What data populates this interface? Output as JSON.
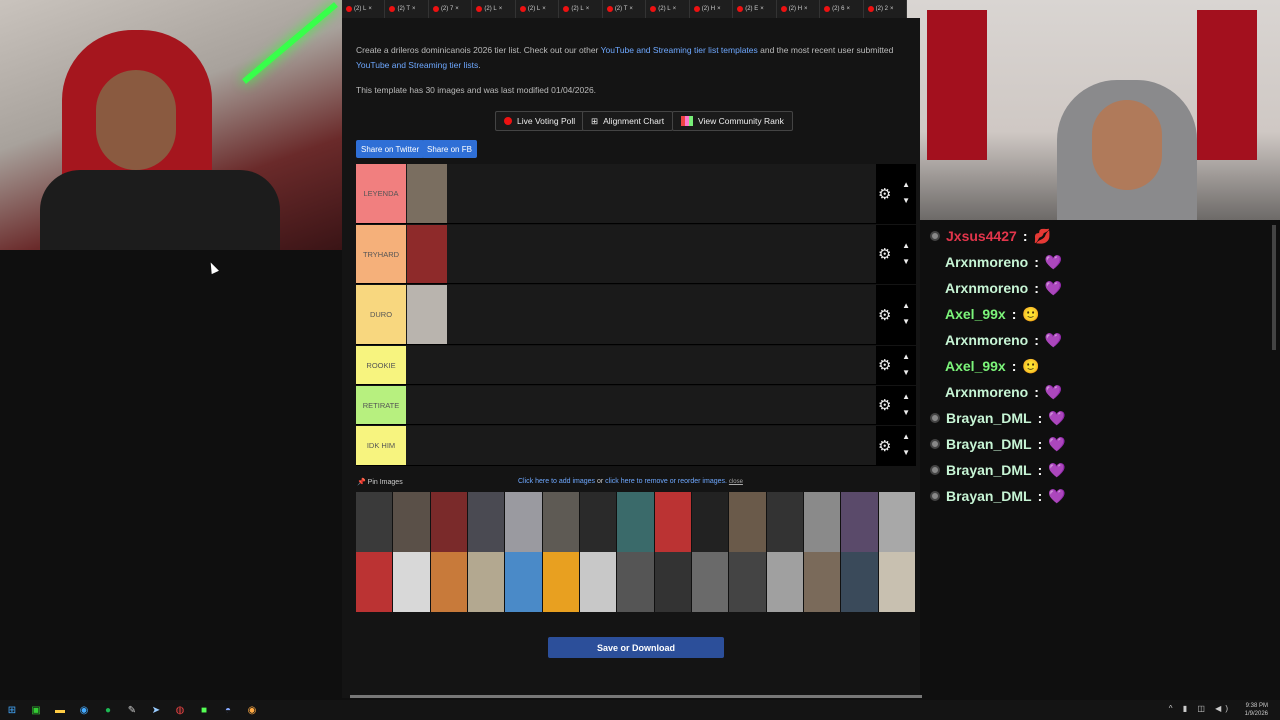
{
  "tabs": [
    "(2) L",
    "(2) T",
    "(2) 7",
    "(2) L",
    "(2) L",
    "(2) L",
    "(2) T",
    "(2) L",
    "(2) H",
    "(2) E",
    "(2) H",
    "(2) 6",
    "(2) 2"
  ],
  "description": {
    "part1": "Create a drileros dominicanois 2026 tier list. Check out our other ",
    "link1": "YouTube and Streaming tier list templates",
    "part2": " and the most recent user submitted ",
    "link2": "YouTube and Streaming tier lists",
    "part3": ".",
    "meta": "This template has 30 images and was last modified 01/04/2026."
  },
  "buttons": {
    "voting": "Live Voting Poll",
    "alignment": "Alignment Chart",
    "community": "View Community Rank",
    "twitter": "Share on Twitter",
    "fb": "Share on FB",
    "save": "Save or Download"
  },
  "tiers": [
    {
      "label": "LEYENDA",
      "color": "#f17f7f"
    },
    {
      "label": "TRYHARD",
      "color": "#f5b07a"
    },
    {
      "label": "DURO",
      "color": "#f8d77f"
    },
    {
      "label": "ROOKIE",
      "color": "#f7f47f"
    },
    {
      "label": "RETIRATE",
      "color": "#b7f07f"
    },
    {
      "label": "IDK HIM",
      "color": "#f7f47f"
    }
  ],
  "pin_label": "Pin Images",
  "add_images": {
    "text1": "Click here to add images",
    "text2": " or ",
    "text3": "click here to remove or reorder images.",
    "close": "close"
  },
  "chat": [
    {
      "user": "Jxsus4427",
      "color": "#e2354b",
      "emote": "💋",
      "badge": true
    },
    {
      "user": "Arxnmoreno",
      "color": "#c7f5d5",
      "emote": "💜"
    },
    {
      "user": "Arxnmoreno",
      "color": "#c7f5d5",
      "emote": "💜"
    },
    {
      "user": "Axel_99x",
      "color": "#7cf57a",
      "emote": "🙂"
    },
    {
      "user": "Arxnmoreno",
      "color": "#c7f5d5",
      "emote": "💜"
    },
    {
      "user": "Axel_99x",
      "color": "#7cf57a",
      "emote": "🙂"
    },
    {
      "user": "Arxnmoreno",
      "color": "#c7f5d5",
      "emote": "💜"
    },
    {
      "user": "Brayan_DML",
      "color": "#c7f5d5",
      "emote": "💜",
      "badge": true
    },
    {
      "user": "Brayan_DML",
      "color": "#c7f5d5",
      "emote": "💜",
      "badge": true
    },
    {
      "user": "Brayan_DML",
      "color": "#c7f5d5",
      "emote": "💜",
      "badge": true
    },
    {
      "user": "Brayan_DML",
      "color": "#c7f5d5",
      "emote": "💜",
      "badge": true
    }
  ],
  "clock": {
    "time": "9:38 PM",
    "date": "1/9/2026"
  }
}
